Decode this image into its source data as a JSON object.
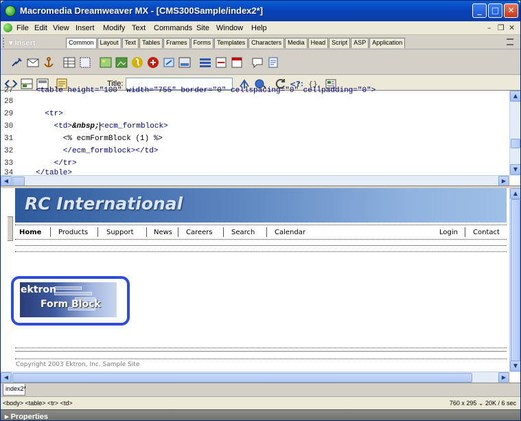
{
  "window": {
    "title": "Macromedia Dreamweaver MX - [CMS300Sample/index2*]"
  },
  "menu": [
    "File",
    "Edit",
    "View",
    "Insert",
    "Modify",
    "Text",
    "Commands",
    "Site",
    "Window",
    "Help"
  ],
  "insert_bar": {
    "label": "▾ Insert",
    "tabs": [
      "Common",
      "Layout",
      "Text",
      "Tables",
      "Frames",
      "Forms",
      "Templates",
      "Characters",
      "Media",
      "Head",
      "Script",
      "ASP",
      "Application"
    ],
    "active_tab": "Common"
  },
  "doc_toolbar": {
    "title_label": "Title:",
    "title_value": ""
  },
  "code": {
    "lines": [
      {
        "n": "28",
        "tokens": []
      },
      {
        "n": "29",
        "tokens": [
          {
            "t": "    <tr>",
            "c": "tag"
          }
        ]
      },
      {
        "n": "30",
        "tokens": [
          {
            "t": "      <td>",
            "c": "tag"
          },
          {
            "t": "&nbsp;",
            "c": "ent"
          },
          {
            "t": "<ecm_formblock>",
            "c": "tag"
          }
        ]
      },
      {
        "n": "31",
        "tokens": [
          {
            "t": "        <% ecmFormBlock (1) %>",
            "c": "asp"
          }
        ]
      },
      {
        "n": "32",
        "tokens": [
          {
            "t": "        </ecm_formblock></td>",
            "c": "tag"
          }
        ]
      },
      {
        "n": "33",
        "tokens": [
          {
            "t": "      </tr>",
            "c": "tag"
          }
        ]
      }
    ]
  },
  "design": {
    "logo": "RC International",
    "nav_left": [
      "Home",
      "Products",
      "Support",
      "News",
      "Careers",
      "Search",
      "Calendar"
    ],
    "nav_right": [
      "Login",
      "Contact"
    ],
    "ektron_word": "ektron",
    "form_block_label": "Form Block",
    "copyright": "Copyright 2003 Ektron, Inc. Sample Site"
  },
  "doc_tabs": [
    "index2*"
  ],
  "status": {
    "tag_selector": "<body> <table> <tr> <td>",
    "size_info": "760 x 295 ⌄  20K / 6 sec"
  },
  "properties_label": "▸ Properties",
  "colors": {
    "title_bar": "#0842b8",
    "highlight": "#2e4be0",
    "banner": "#5d86c0"
  }
}
